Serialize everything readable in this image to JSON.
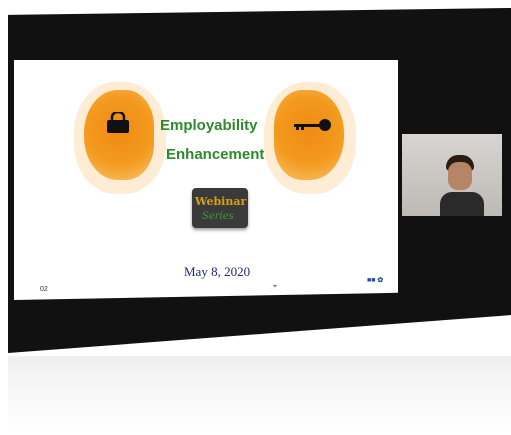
{
  "slide": {
    "title_line1": "Employability",
    "title_line2": "Enhancement",
    "badge_line1": "Webinar",
    "badge_line2": "Series",
    "date": "May 8, 2020",
    "page_number": "02"
  },
  "colors": {
    "window_bg": "#111111",
    "title_green": "#2d8a2d",
    "head_orange": "#f39a1f",
    "date_blue": "#1c2a6e"
  }
}
